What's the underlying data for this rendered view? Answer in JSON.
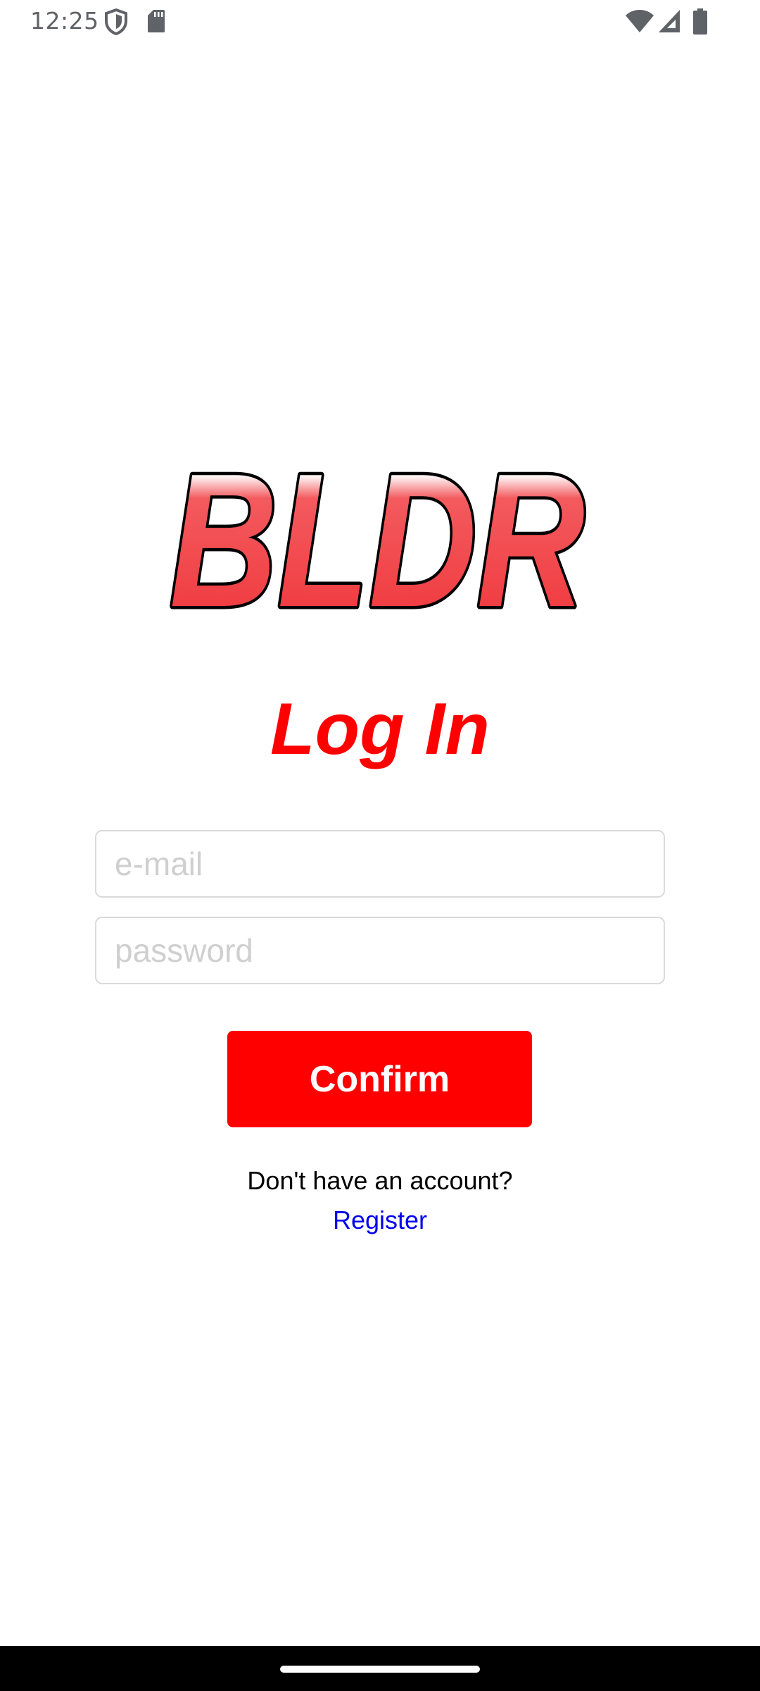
{
  "status_bar": {
    "time": "12:25",
    "icons": [
      "shield-icon",
      "sd-card-icon",
      "wifi-icon",
      "cell-signal-icon",
      "battery-icon"
    ]
  },
  "logo": {
    "text": "BLDR",
    "colors": {
      "fill": "#f0393f",
      "highlight": "#ffffff",
      "outline": "#000000"
    }
  },
  "login": {
    "title": "Log In",
    "email_placeholder": "e-mail",
    "email_value": "",
    "password_placeholder": "password",
    "password_value": "",
    "confirm_label": "Confirm",
    "no_account_text": "Don't have an account?",
    "register_label": "Register"
  },
  "colors": {
    "accent": "#ff0000",
    "link": "#0000ee",
    "field_border": "#dadada",
    "placeholder": "#cfcfcf"
  }
}
